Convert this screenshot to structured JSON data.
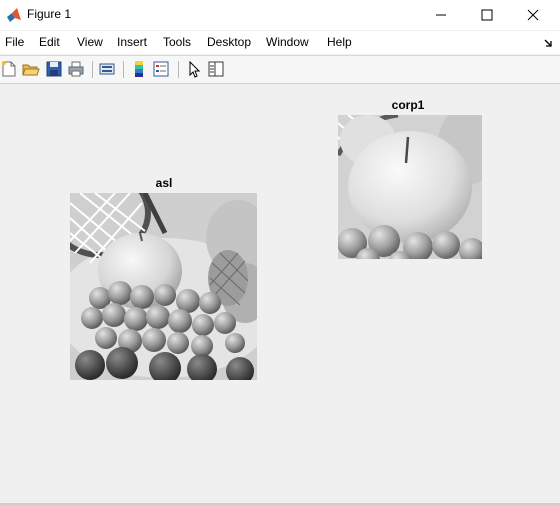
{
  "window": {
    "title": "Figure 1",
    "controls": [
      "minimize-icon",
      "maximize-icon",
      "close-icon"
    ]
  },
  "menu": {
    "items": [
      "File",
      "Edit",
      "View",
      "Insert",
      "Tools",
      "Desktop",
      "Window",
      "Help"
    ]
  },
  "toolbar": {
    "buttons": [
      "new-figure-icon",
      "open-file-icon",
      "save-icon",
      "print-icon",
      "link-plot-icon",
      "insert-colorbar-icon",
      "insert-legend-icon",
      "edit-plot-arrow-icon",
      "property-inspector-icon"
    ]
  },
  "figure": {
    "axes": [
      {
        "title": "asl",
        "content": "grayscale fruit image"
      },
      {
        "title": "corp1",
        "content": "grayscale cropped apple image"
      }
    ]
  },
  "colors": {
    "window_bg": "#f0f0f0",
    "titlebar_bg": "#ffffff",
    "menubar_bg": "#ffffff",
    "toolbar_bg": "#f7f7f7"
  }
}
